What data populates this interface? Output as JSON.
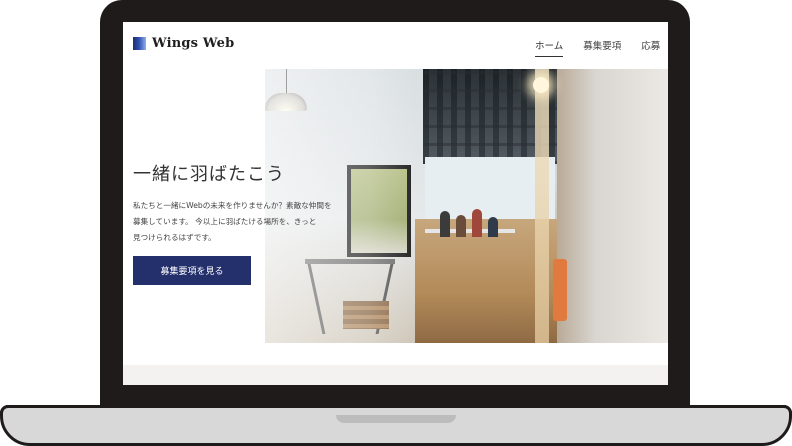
{
  "site": {
    "logo_text": "Wings Web",
    "logo_icon": "gradient-square-icon"
  },
  "nav": {
    "items": [
      {
        "label": "ホーム",
        "active": true
      },
      {
        "label": "募集要項",
        "active": false
      },
      {
        "label": "応募",
        "active": false
      }
    ]
  },
  "hero": {
    "title": "一緒に羽ばたこう",
    "description_lines": [
      "私たちと一緒にWebの未来を作りませんか？素敵な仲間を",
      "募集しています。 今以上に羽ばたける場所を、きっと",
      "見つけられるはずです。"
    ],
    "cta_label": "募集要項を見る",
    "image_alt": "office-interior-photo"
  },
  "colors": {
    "accent": "#24306b",
    "laptop_frame": "#1f1b1a"
  }
}
